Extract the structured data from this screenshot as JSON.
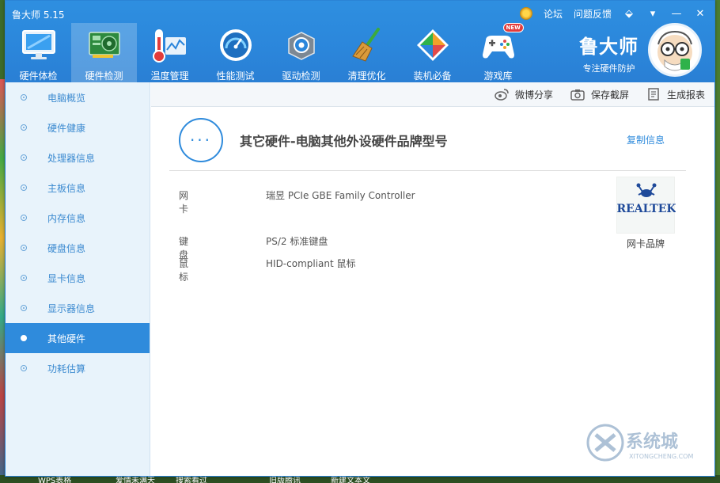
{
  "window": {
    "title": "鲁大师 5.15",
    "top_links": [
      "论坛",
      "问题反馈"
    ],
    "controls": [
      "⬙",
      "▾",
      "—",
      "✕"
    ]
  },
  "nav": {
    "items": [
      {
        "label": "硬件体检",
        "icon": "monitor-icon"
      },
      {
        "label": "硬件检测",
        "icon": "graphics-card-icon"
      },
      {
        "label": "温度管理",
        "icon": "thermometer-icon"
      },
      {
        "label": "性能测试",
        "icon": "speedometer-icon"
      },
      {
        "label": "驱动检测",
        "icon": "gear-box-icon"
      },
      {
        "label": "清理优化",
        "icon": "broom-icon"
      },
      {
        "label": "装机必备",
        "icon": "cube-icon"
      },
      {
        "label": "游戏库",
        "icon": "gamepad-icon",
        "badge": "NEW"
      }
    ],
    "active_index": 1
  },
  "brand": {
    "name": "鲁大师",
    "slogan": "专注硬件防护"
  },
  "sidebar": {
    "items": [
      "电脑概览",
      "硬件健康",
      "处理器信息",
      "主板信息",
      "内存信息",
      "硬盘信息",
      "显卡信息",
      "显示器信息",
      "其他硬件",
      "功耗估算"
    ],
    "active_index": 8
  },
  "toolbar": {
    "share": "微博分享",
    "screenshot": "保存截屏",
    "report": "生成报表"
  },
  "content": {
    "icon_text": "···",
    "title": "其它硬件-电脑其他外设硬件品牌型号",
    "copy": "复制信息",
    "rows": [
      {
        "key": "网卡",
        "value": "瑞昱 PCIe GBE Family Controller"
      },
      {
        "key": "键盘",
        "value": "PS/2 标准键盘"
      },
      {
        "key": "鼠标",
        "value": "HID-compliant 鼠标"
      }
    ],
    "brand_logo_text": "REALTEK",
    "brand_caption": "网卡品牌"
  },
  "desktop": {
    "taskbar_labels": [
      "WPS表格",
      "爱情未满天",
      "搜索看过",
      "旧版腾讯",
      "新建文本文"
    ]
  },
  "watermark": {
    "text": "系统城",
    "sub": "XITONGCHENG.COM"
  },
  "colors": {
    "accent": "#2f8bdc",
    "header": "#2b86db",
    "sidebar_bg": "#e8f3fb"
  }
}
